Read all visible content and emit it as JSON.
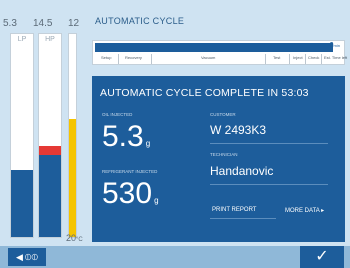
{
  "gauges": [
    {
      "value": "5.3",
      "label": "LP",
      "fill_fraction": 0.33,
      "fill_color": "#1d5d9b"
    },
    {
      "value": "14.5",
      "label": "HP",
      "fill_fraction": 0.45,
      "fill_color": "#e53935"
    },
    {
      "value": "12",
      "label": "",
      "fill_fraction": 0.58,
      "fill_color": "#f5c400"
    }
  ],
  "gauge_unit": "20",
  "gauge_unit_sub": "°C",
  "header": {
    "title": "AUTOMATIC CYCLE"
  },
  "progress": {
    "right_value": "0",
    "right_unit": "min",
    "fill_fraction": 0.95,
    "steps": [
      "Setup",
      "Recovery",
      "Vacuum",
      "Test",
      "Inject",
      "Check",
      "Est. Time left"
    ]
  },
  "panel": {
    "title": "AUTOMATIC CYCLE COMPLETE IN 53:03",
    "oil_label": "OIL INJECTED",
    "oil_value": "5.3",
    "oil_unit": "g",
    "ref_label": "REFRIGERANT INJECTED",
    "ref_value": "530",
    "ref_unit": "g",
    "customer_label": "CUSTOMER",
    "customer_value": "W 2493K3",
    "technician_label": "TECHNICIAN",
    "technician_value": "Handanovic",
    "print_label": "PRINT REPORT",
    "more_label": "MORE DATA"
  },
  "bottom": {
    "nav_arrow": "◀",
    "nav_icon": "⦶⦶",
    "confirm": "✓"
  },
  "colors": {
    "accent": "#1d5d9b",
    "background": "#cfe3f2",
    "lp": "#1d5d9b",
    "hp": "#e53935",
    "temp": "#f5c400"
  }
}
